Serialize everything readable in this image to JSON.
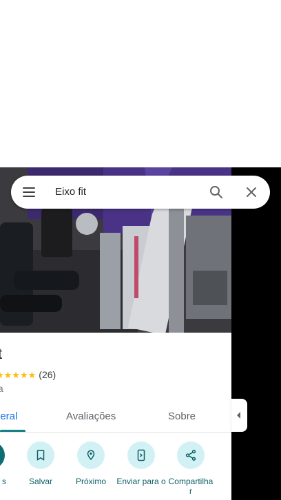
{
  "search": {
    "query": "Eixo fit"
  },
  "place": {
    "name": "fit",
    "rating_stars": "★★★★★",
    "review_count": "(26)",
    "category": "nia"
  },
  "tabs": [
    {
      "label": "geral"
    },
    {
      "label": "Avaliações"
    },
    {
      "label": "Sobre"
    }
  ],
  "actions": [
    {
      "label": "s",
      "icon": "directions-icon"
    },
    {
      "label": "Salvar",
      "icon": "bookmark-icon"
    },
    {
      "label": "Próximo",
      "icon": "nearby-icon"
    },
    {
      "label": "Enviar para o",
      "icon": "send-to-phone-icon"
    },
    {
      "label": "Compartilha r",
      "icon": "share-icon"
    }
  ],
  "colors": {
    "accent": "#137f82",
    "action_circle": "#d2f1f5",
    "action_label": "#0b5f66",
    "star": "#fbbc04"
  }
}
